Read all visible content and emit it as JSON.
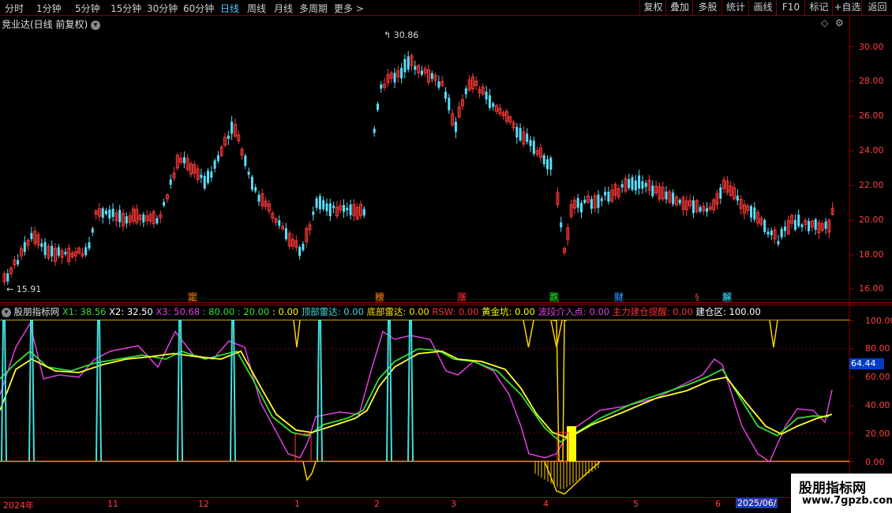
{
  "toolbar": {
    "periods": [
      "分时",
      "1分钟",
      "5分钟",
      "15分钟",
      "30分钟",
      "60分钟",
      "日线",
      "周线",
      "月线",
      "多周期",
      "更多"
    ],
    "active_period": "日线",
    "right_buttons": [
      "复权",
      "叠加",
      "多股",
      "统计",
      "画线",
      "F10",
      "标记",
      "+自选",
      "返回"
    ]
  },
  "main_pane": {
    "title": "竞业达(日线 前复权)",
    "price_axis": [
      "30.00",
      "28.00",
      "26.00",
      "24.00",
      "22.00",
      "20.00",
      "18.00",
      "16.00"
    ],
    "high_label": "30.86",
    "low_label": "15.91",
    "markers": [
      {
        "text": "定",
        "color": "#ff7a1a"
      },
      {
        "text": "榜",
        "color": "#ff7a1a"
      },
      {
        "text": "涨",
        "color": "#ff3a3a"
      },
      {
        "text": "跌",
        "color": "#30e030"
      },
      {
        "text": "财",
        "color": "#3aa8ff"
      },
      {
        "text": "§",
        "color": "#ff3a3a"
      },
      {
        "text": "解",
        "color": "#58d8ff"
      }
    ]
  },
  "indicator_pane": {
    "name": "股朋指标网",
    "items": [
      {
        "text": "X1: 38.56",
        "color": "#30e030"
      },
      {
        "text": "X2: 32.50",
        "color": "#ffffff"
      },
      {
        "text": "X3: 50.68",
        "color": "#e040e0"
      },
      {
        "text": ": 80.00",
        "color": "#30e030"
      },
      {
        "text": ": 20.00",
        "color": "#30e030"
      },
      {
        "text": ": 0.00",
        "color": "#ffff00"
      },
      {
        "text": "顶部雷达: 0.00",
        "color": "#40d8d8"
      },
      {
        "text": "底部雷达: 0.00",
        "color": "#ffe000"
      },
      {
        "text": "RSW: 0.00",
        "color": "#ff3030"
      },
      {
        "text": "黄金坑: 0.00",
        "color": "#ffff00"
      },
      {
        "text": "波段介入点: 0.00",
        "color": "#e040e0"
      },
      {
        "text": "主力建仓提醒: 0.00",
        "color": "#ff3030"
      },
      {
        "text": "建仓区: 100.00",
        "color": "#ffffff"
      }
    ],
    "axis": [
      "100.00",
      "80.00",
      "60.00",
      "40.00",
      "20.00",
      "0.00"
    ],
    "current_value": "64.44"
  },
  "time_axis": [
    "2024年",
    "11",
    "12",
    "1",
    "2",
    "3",
    "4",
    "5",
    "6",
    "2025/06/"
  ],
  "watermark": {
    "line1": "股朋指标网",
    "line2": "www.7gpzb.com"
  }
}
